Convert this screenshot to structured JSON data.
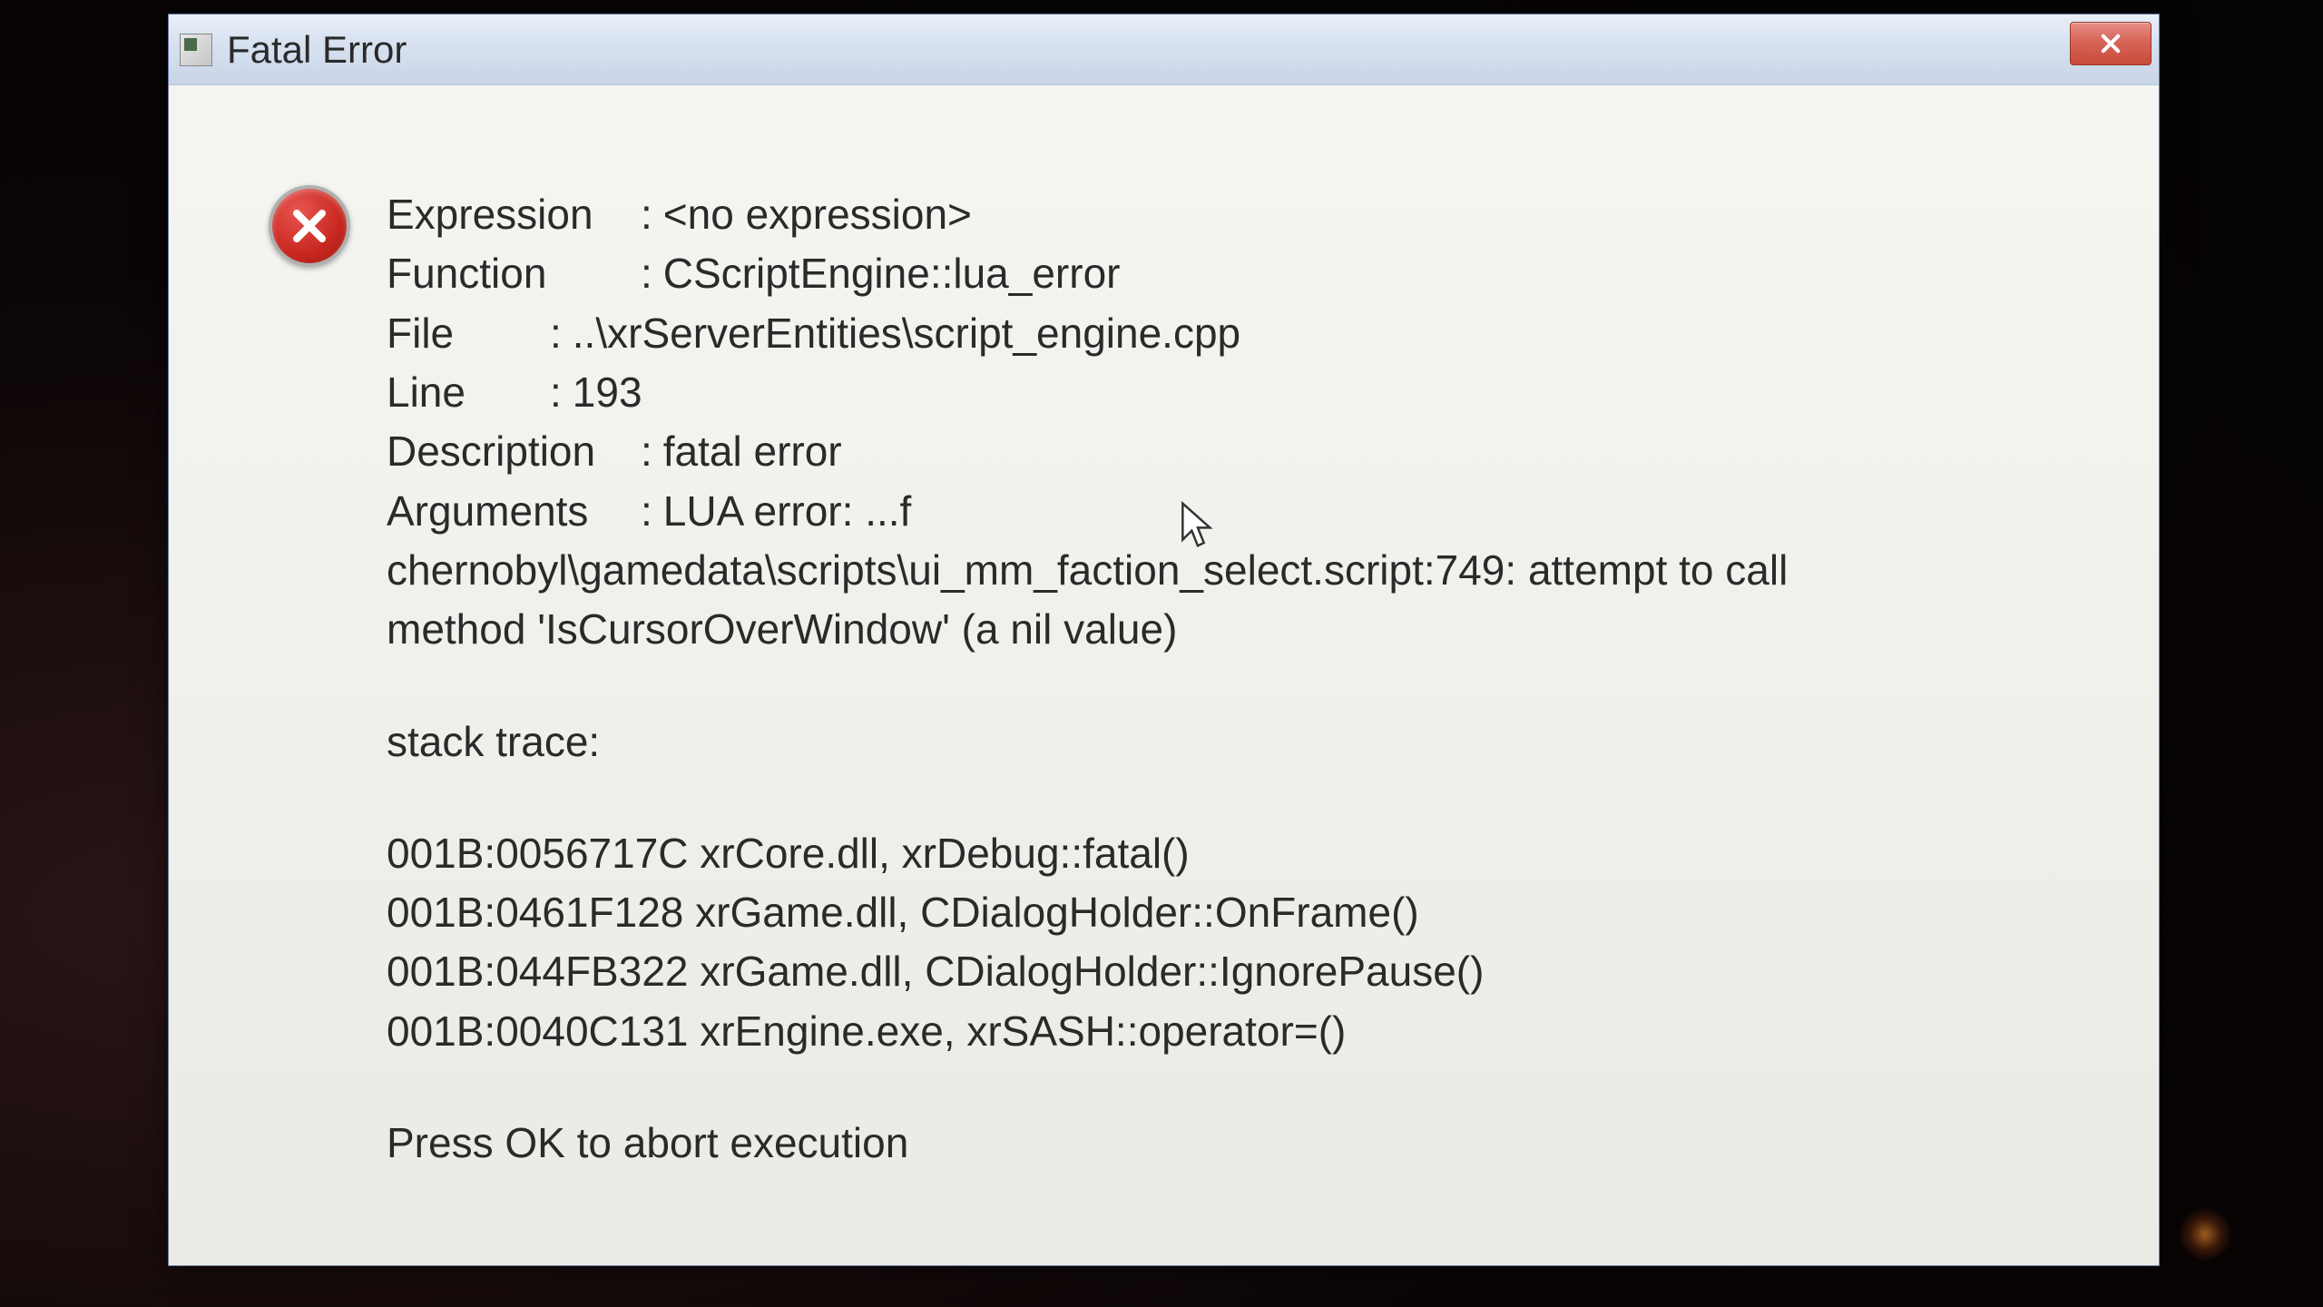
{
  "dialog": {
    "title": "Fatal Error",
    "fields": {
      "expression": {
        "label": "Expression",
        "value": "<no expression>"
      },
      "function": {
        "label": "Function",
        "value": "CScriptEngine::lua_error"
      },
      "file": {
        "label": "File",
        "value": "..\\xrServerEntities\\script_engine.cpp"
      },
      "line": {
        "label": "Line",
        "value": "193"
      },
      "description": {
        "label": "Description",
        "value": "fatal error"
      },
      "arguments": {
        "label": "Arguments",
        "value": "LUA error: ...f"
      }
    },
    "wrap_text": "chernobyl\\gamedata\\scripts\\ui_mm_faction_select.script:749: attempt to call method 'IsCursorOverWindow' (a nil value)",
    "stack_label": "stack trace:",
    "stack": [
      "001B:0056717C xrCore.dll, xrDebug::fatal()",
      "001B:0461F128 xrGame.dll, CDialogHolder::OnFrame()",
      "001B:044FB322 xrGame.dll, CDialogHolder::IgnorePause()",
      "001B:0040C131 xrEngine.exe, xrSASH::operator=()"
    ],
    "prompt": "Press OK to abort execution"
  }
}
